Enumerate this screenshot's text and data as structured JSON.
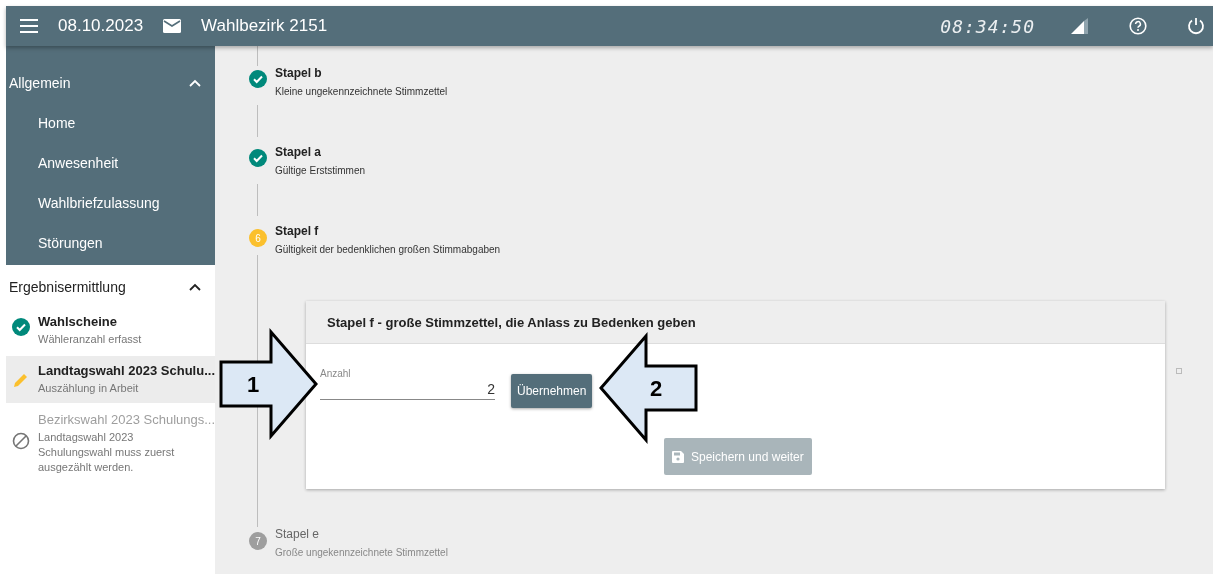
{
  "header": {
    "date": "08.10.2023",
    "district": "Wahlbezirk 2151",
    "clock": "08:34:50"
  },
  "sidebar": {
    "general": {
      "title": "Allgemein",
      "expanded": true,
      "items": [
        {
          "label": "Home"
        },
        {
          "label": "Anwesenheit"
        },
        {
          "label": "Wahlbriefzulassung"
        },
        {
          "label": "Störungen"
        }
      ]
    },
    "results": {
      "title": "Ergebnisermittlung",
      "expanded": true,
      "items": [
        {
          "title": "Wahlscheine",
          "subtitle": "Wähleranzahl erfasst",
          "kind": "done",
          "selected": false
        },
        {
          "title": "Landtagswahl 2023 Schulu...",
          "subtitle": "Auszählung in Arbeit",
          "kind": "progress",
          "selected": true
        },
        {
          "title": "Bezirkswahl 2023 Schulungs...",
          "subtitle": "Landtagswahl 2023 Schulungswahl muss zuerst ausgezählt werden.",
          "kind": "blocked",
          "selected": false
        }
      ]
    }
  },
  "steps": [
    {
      "title": "Stapel b",
      "subtitle": "Kleine ungekennzeichnete Stimmzettel",
      "kind": "done"
    },
    {
      "title": "Stapel a",
      "subtitle": "Gültige Erststimmen",
      "kind": "done"
    },
    {
      "title": "Stapel f",
      "subtitle": "Gültigkeit der bedenklichen großen Stimmabgaben",
      "kind": "active",
      "number": "6"
    },
    {
      "title": "Stapel e",
      "subtitle": "Große ungekennzeichnete Stimmzettel",
      "kind": "pending",
      "number": "7"
    }
  ],
  "card": {
    "title": "Stapel f - große Stimmzettel, die Anlass zu Bedenken geben",
    "field": {
      "label": "Anzahl",
      "value": "2"
    },
    "apply_button": "Übernehmen",
    "save_button": {
      "label": "Speichern und weiter",
      "disabled": true
    }
  },
  "callouts": [
    {
      "label": "1",
      "kind": "right"
    },
    {
      "label": "2",
      "kind": "left"
    }
  ]
}
